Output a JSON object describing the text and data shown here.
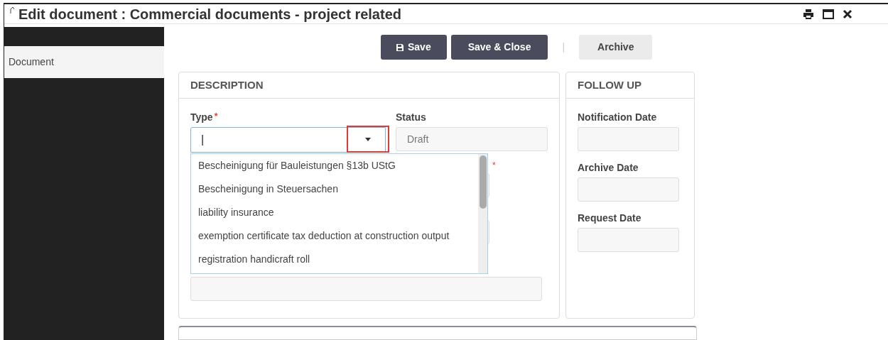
{
  "window": {
    "title": "Edit document : Commercial documents - project related"
  },
  "sidebar": {
    "items": [
      {
        "label": "Document",
        "selected": true
      }
    ]
  },
  "toolbar": {
    "buttons": [
      {
        "kind": "save",
        "label": "Save"
      },
      {
        "kind": "primary",
        "label": "Save & Close"
      },
      {
        "kind": "separator",
        "label": "|"
      },
      {
        "kind": "light",
        "label": "Archive"
      }
    ]
  },
  "description": {
    "title": "DESCRIPTION",
    "type_field": {
      "label": "Type",
      "required_mark": "*",
      "value": "|",
      "highlighted": true
    },
    "status_field": {
      "label": "Status",
      "value": "Draft"
    },
    "hidden_fields": [
      {
        "kind": "short",
        "required_mark": "*"
      },
      {
        "kind": "short"
      },
      {
        "kind": "wide"
      }
    ],
    "dropdown": {
      "options": [
        {
          "label": "Bescheinigung für Bauleistungen §13b UStG"
        },
        {
          "label": "Bescheinigung in Steuersachen"
        },
        {
          "label": "liability insurance"
        },
        {
          "label": "exemption certificate tax deduction at construction output"
        },
        {
          "label": "registration handicraft roll"
        }
      ]
    }
  },
  "follow_up": {
    "title": "FOLLOW UP",
    "fields": [
      {
        "label": "Notification Date"
      },
      {
        "label": "Archive Date"
      },
      {
        "label": "Request Date"
      }
    ]
  }
}
